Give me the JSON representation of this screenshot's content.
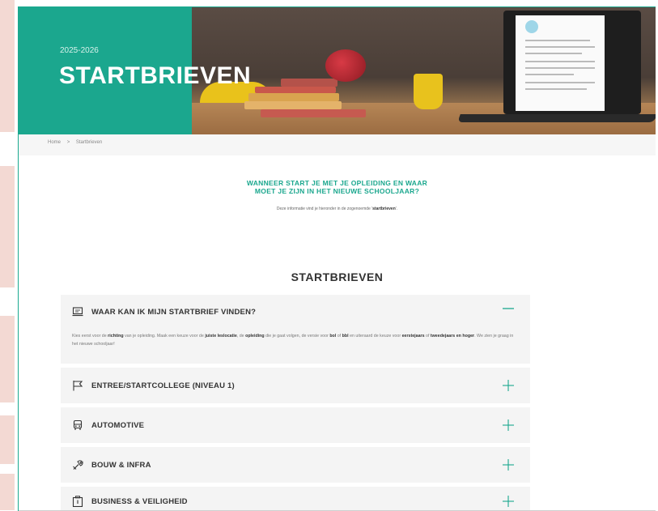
{
  "hero": {
    "year": "2025-2026",
    "title": "STARTBRIEVEN"
  },
  "breadcrumb": {
    "home": "Home",
    "separator": ">",
    "current": "Startbrieven"
  },
  "intro": {
    "heading_line1": "WANNEER START JE MET JE OPLEIDING EN WAAR",
    "heading_line2": "MOET JE ZIJN IN HET NIEUWE SCHOOLJAAR?",
    "text_before": "Deze informatie vind je hieronder in de zogenoemde '",
    "text_bold": "startbrieven",
    "text_after": "'."
  },
  "section_title": "STARTBRIEVEN",
  "accordion": {
    "items": [
      {
        "label": "WAAR KAN IK MIJN STARTBRIEF VINDEN?",
        "icon": "laptop-icon",
        "expanded": true
      },
      {
        "label": "ENTREE/STARTCOLLEGE (NIVEAU 1)",
        "icon": "flag-icon",
        "expanded": false
      },
      {
        "label": "AUTOMOTIVE",
        "icon": "car-icon",
        "expanded": false
      },
      {
        "label": "BOUW & INFRA",
        "icon": "tools-icon",
        "expanded": false
      },
      {
        "label": "BUSINESS & VEILIGHEID",
        "icon": "briefcase-icon",
        "expanded": false
      }
    ],
    "body": {
      "t1": "Kies eerst voor de ",
      "b1": "richting",
      "t2": " van je opleiding. Maak een keuze voor de ",
      "b2": "juiste leslocatie",
      "t3": ", de ",
      "b3": "opleiding",
      "t4": " die je gaat volgen, de versie voor ",
      "b4": "bol",
      "t5": " of ",
      "b5": "bbl",
      "t6": " en uiteraard de keuze voor ",
      "b6": "eerstejaars",
      "t7": " of ",
      "b7": "tweedejaars en hoger",
      "t8": ". We zien je graag in het nieuwe schooljaar!"
    }
  },
  "colors": {
    "accent": "#1ba78e",
    "text": "#333333",
    "panel": "#f4f4f4"
  }
}
